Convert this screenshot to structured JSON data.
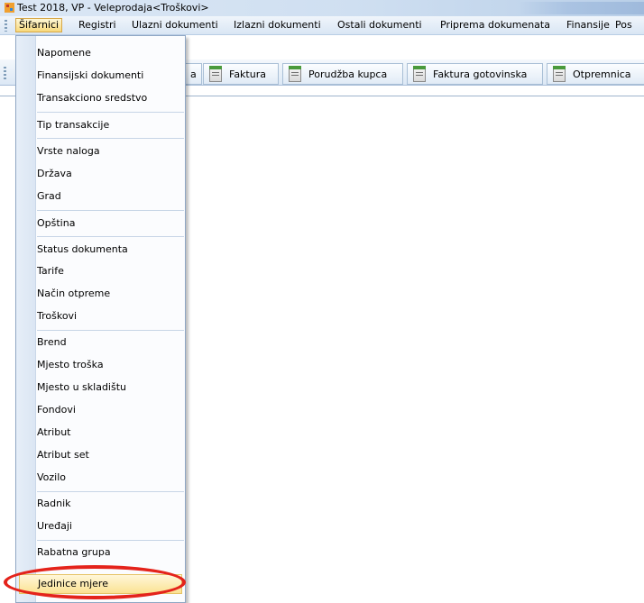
{
  "window": {
    "title": "Test 2018, VP - Veleprodaja<Troškovi>"
  },
  "menubar": {
    "items": [
      {
        "label": "Šifarnici",
        "active": true
      },
      {
        "label": "Registri"
      },
      {
        "label": "Ulazni dokumenti"
      },
      {
        "label": "Izlazni dokumenti"
      },
      {
        "label": "Ostali dokumenti"
      },
      {
        "label": "Priprema dokumenata"
      },
      {
        "label": "Finansije"
      },
      {
        "label": "Pos"
      }
    ]
  },
  "toolbar": {
    "buttons": [
      {
        "label": "a",
        "icon": "document-icon"
      },
      {
        "label": "Faktura",
        "icon": "document-icon"
      },
      {
        "label": "Porudžba kupca",
        "icon": "document-icon"
      },
      {
        "label": "Faktura gotovinska",
        "icon": "document-icon"
      },
      {
        "label": "Otpremnica",
        "icon": "document-icon"
      }
    ]
  },
  "dropdown": {
    "items": [
      {
        "label": "Napomene"
      },
      {
        "label": "Finansijski dokumenti"
      },
      {
        "label": "Transakciono sredstvo"
      },
      {
        "label": "Tip transakcije"
      },
      {
        "label": "Vrste naloga"
      },
      {
        "label": "Država"
      },
      {
        "label": "Grad"
      },
      {
        "label": "Opština"
      },
      {
        "label": "Status dokumenta"
      },
      {
        "label": "Tarife"
      },
      {
        "label": "Način otpreme"
      },
      {
        "label": "Troškovi"
      },
      {
        "label": "Brend"
      },
      {
        "label": "Mjesto troška"
      },
      {
        "label": "Mjesto u skladištu"
      },
      {
        "label": "Fondovi"
      },
      {
        "label": "Atribut"
      },
      {
        "label": "Atribut set"
      },
      {
        "label": "Vozilo"
      },
      {
        "label": "Radnik"
      },
      {
        "label": "Uređaji"
      },
      {
        "label": "Rabatna grupa"
      },
      {
        "label": "Jedinice mjere",
        "highlighted": true,
        "annotated": true
      }
    ]
  },
  "colors": {
    "annotation_ring": "#e4231b",
    "highlight": "#fbe293"
  }
}
